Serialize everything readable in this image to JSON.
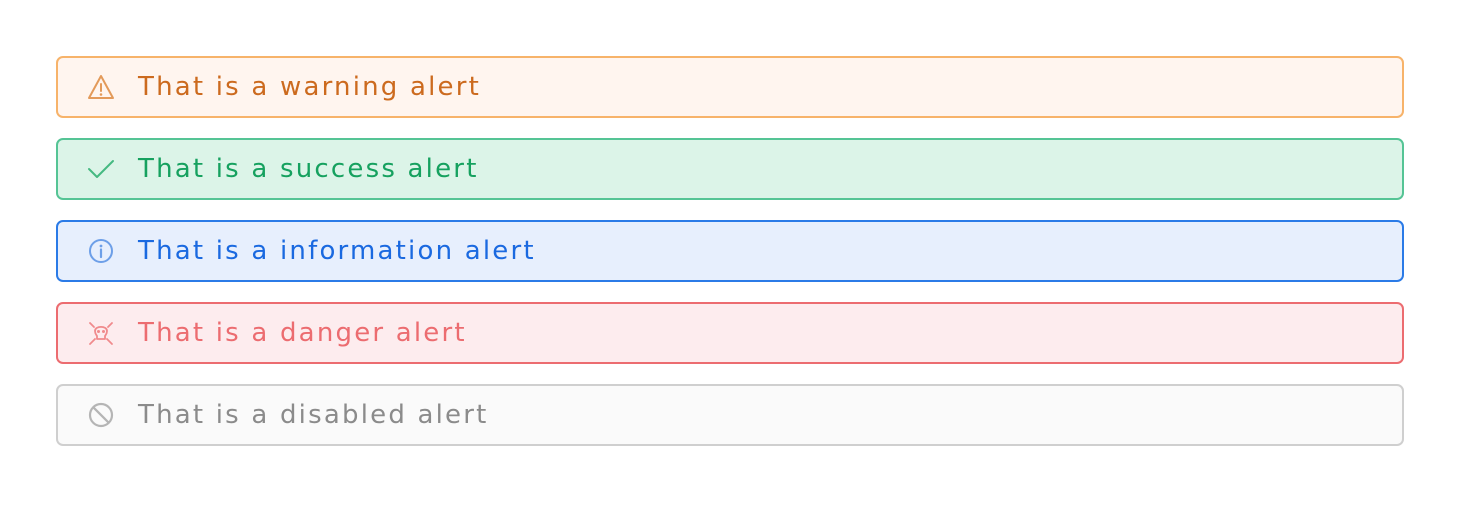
{
  "alerts": [
    {
      "variant": "warning",
      "icon": "warning-triangle-icon",
      "text": "That is a warning alert",
      "colors": {
        "background": "#fff5ef",
        "border": "#f7b36a",
        "text": "#cc6a1e",
        "icon": "#e39a5a"
      }
    },
    {
      "variant": "success",
      "icon": "checkmark-icon",
      "text": "That is a success alert",
      "colors": {
        "background": "#dcf4e8",
        "border": "#55c495",
        "text": "#16a15f",
        "icon": "#45b981"
      }
    },
    {
      "variant": "information",
      "icon": "info-circle-icon",
      "text": "That is a information alert",
      "colors": {
        "background": "#e7effd",
        "border": "#2b7be7",
        "text": "#1a69e0",
        "icon": "#6d9fe8"
      }
    },
    {
      "variant": "danger",
      "icon": "skull-crossbones-icon",
      "text": "That is a danger alert",
      "colors": {
        "background": "#fdecee",
        "border": "#ec6c70",
        "text": "#ec6c70",
        "icon": "#f08a8c"
      }
    },
    {
      "variant": "disabled",
      "icon": "prohibited-icon",
      "text": "That is a disabled alert",
      "colors": {
        "background": "#fafafa",
        "border": "#cfcfcf",
        "text": "#8b8b8b",
        "icon": "#b5b5b5"
      }
    }
  ]
}
